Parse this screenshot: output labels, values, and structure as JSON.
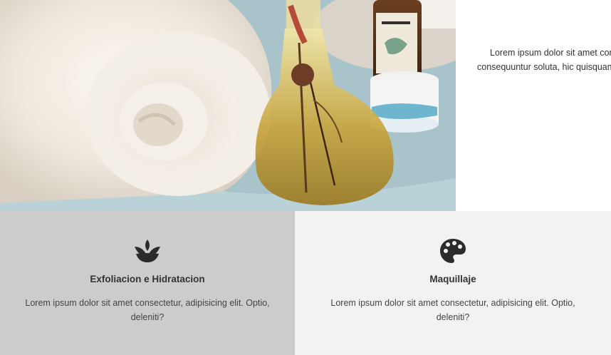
{
  "hero": {
    "image_icon": "spa-towel-oil-photo",
    "text_line1": "Lorem ipsum dolor sit amet cons",
    "text_line2": "consequuntur soluta, hic quisquam"
  },
  "services": [
    {
      "icon": "lotus-icon",
      "title": "Exfoliacion e Hidratacion",
      "description": "Lorem ipsum dolor sit amet consectetur, adipisicing elit. Optio, deleniti?",
      "background": "#cccccc"
    },
    {
      "icon": "palette-icon",
      "title": "Maquillaje",
      "description": "Lorem ipsum dolor sit amet consectetur, adipisicing elit. Optio, deleniti?",
      "background": "#f2f2f2"
    }
  ]
}
